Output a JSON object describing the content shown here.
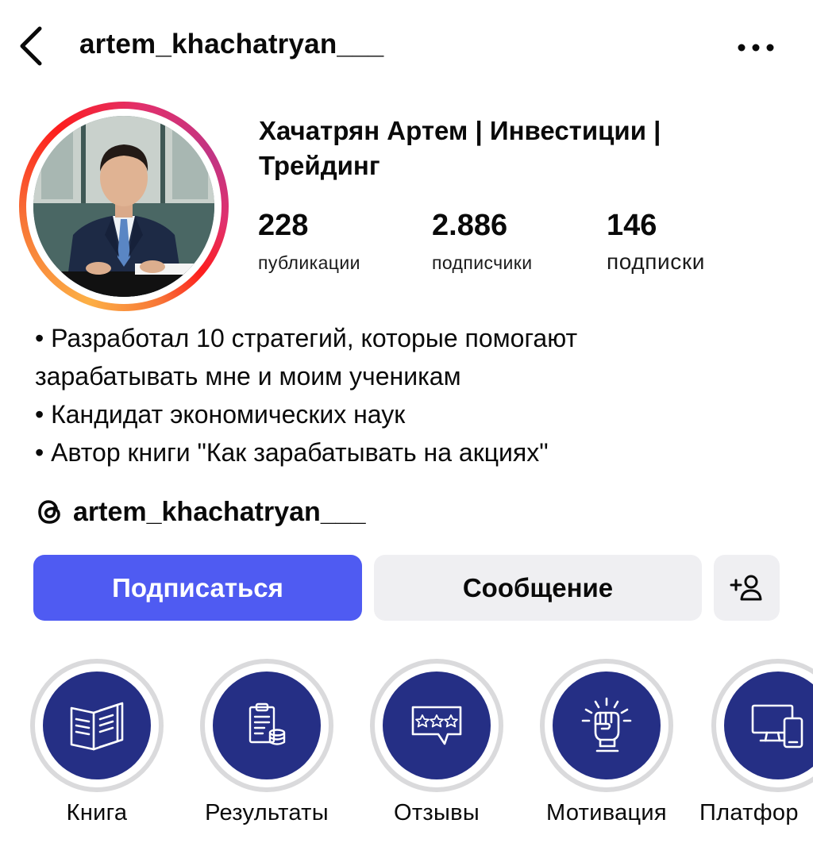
{
  "header": {
    "username": "artem_khachatryan___",
    "back_icon": "chevron-left-icon",
    "more_icon": "more-horizontal-icon"
  },
  "profile": {
    "display_name_line1": "Хачатрян Артем | Инвестиции |",
    "display_name_line2": "Трейдинг",
    "avatar_alt": "profile photo",
    "stats": [
      {
        "value": "228",
        "label": "публикации"
      },
      {
        "value": "2.886",
        "label": "подписчики"
      },
      {
        "value": "146",
        "label": "подписки"
      }
    ]
  },
  "bio": {
    "lines": [
      "• Разработал 10 стратегий, которые помогают",
      "зарабатывать мне и моим ученикам",
      "• Кандидат экономических наук",
      "• Автор книги \"Как зарабатывать на акциях\""
    ]
  },
  "threads": {
    "icon": "threads-icon",
    "handle": "artem_khachatryan___"
  },
  "actions": {
    "follow_label": "Подписаться",
    "message_label": "Сообщение",
    "suggest_icon": "add-person-icon"
  },
  "highlights": [
    {
      "label": "Книга",
      "icon": "book-icon"
    },
    {
      "label": "Результаты",
      "icon": "clipboard-coins-icon"
    },
    {
      "label": "Отзывы",
      "icon": "rating-stars-icon"
    },
    {
      "label": "Мотивация",
      "icon": "raised-fist-icon"
    },
    {
      "label": "Платфор",
      "icon": "devices-icon"
    }
  ],
  "colors": {
    "primary_button": "#4f5bf2",
    "secondary_button": "#efeff2",
    "highlight_fill": "#252f85",
    "highlight_ring": "#dadadc"
  }
}
